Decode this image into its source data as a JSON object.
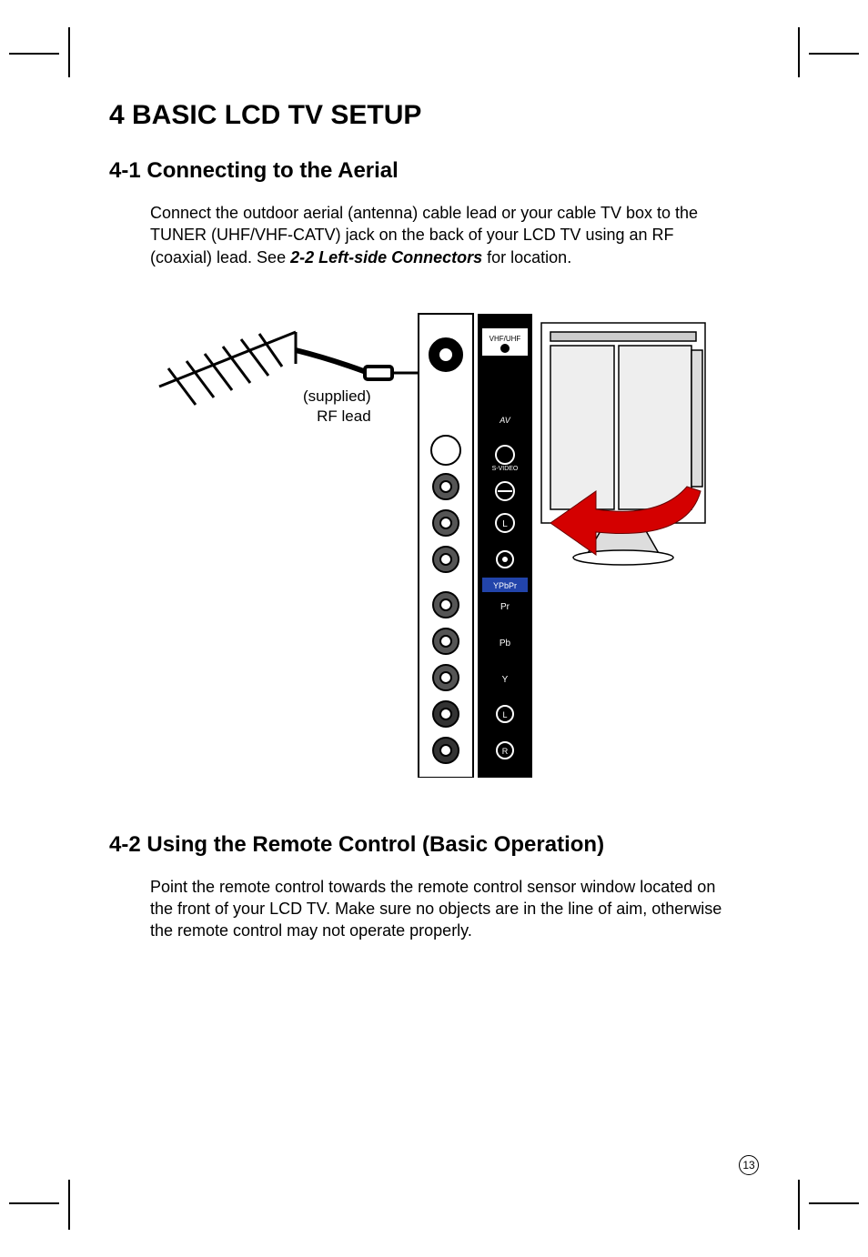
{
  "heading": "4 BASIC LCD TV SETUP",
  "section1": {
    "title": "4-1  Connecting to the Aerial",
    "para_a": "Connect the outdoor aerial (antenna) cable lead or your cable TV box to the TUNER (UHF/VHF-CATV) jack on the back of your LCD TV using an RF (coaxial) lead. See ",
    "ref": "2-2 Left-side Connectors",
    "para_b": " for location.",
    "figure_caption_line1": "(supplied)",
    "figure_caption_line2": "RF lead",
    "connector_labels": {
      "tuner": "VHF/UHF",
      "av": "AV",
      "svideo": "S-VIDEO",
      "audio_l": "L",
      "audio_r": "R",
      "ypbpr": "YPbPr",
      "pr": "Pr",
      "pb": "Pb",
      "y": "Y"
    }
  },
  "section2": {
    "title": "4-2  Using the Remote Control (Basic Operation)",
    "para": "Point the remote control towards the remote control sensor window located on the front of your LCD TV. Make sure no objects are in the line of aim, otherwise the remote control may not operate properly."
  },
  "page_number": "13"
}
